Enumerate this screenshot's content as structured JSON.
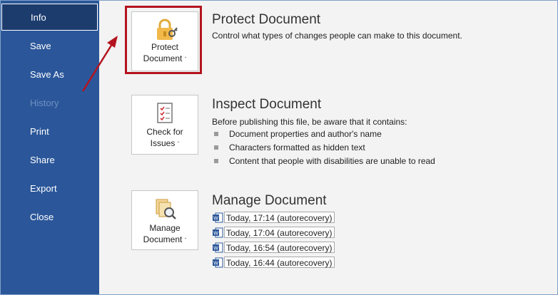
{
  "sidebar": {
    "items": [
      {
        "label": "Info",
        "active": true
      },
      {
        "label": "Save"
      },
      {
        "label": "Save As"
      },
      {
        "label": "History",
        "disabled": true
      },
      {
        "label": "Print"
      },
      {
        "label": "Share"
      },
      {
        "label": "Export"
      },
      {
        "label": "Close"
      }
    ]
  },
  "protect": {
    "button_line1": "Protect",
    "button_line2": "Document",
    "caret": "ˇ",
    "title": "Protect Document",
    "description": "Control what types of changes people can make to this document."
  },
  "inspect": {
    "button_line1": "Check for",
    "button_line2": "Issues",
    "caret": "ˇ",
    "title": "Inspect Document",
    "description": "Before publishing this file, be aware that it contains:",
    "bullets": [
      "Document properties and author's name",
      "Characters formatted as hidden text",
      "Content that people with disabilities are unable to read"
    ]
  },
  "manage": {
    "button_line1": "Manage",
    "button_line2": "Document",
    "caret": "ˇ",
    "title": "Manage Document",
    "versions": [
      "Today, 17:14 (autorecovery)",
      "Today, 17:04 (autorecovery)",
      "Today, 16:54 (autorecovery)",
      "Today, 16:44 (autorecovery)"
    ]
  },
  "colors": {
    "sidebar_bg": "#2b579a",
    "active_bg": "#1d3c6e",
    "highlight": "#b3141f",
    "content_bg": "#f3f3f3"
  },
  "icons": {
    "protect": "lock-key-icon",
    "inspect": "checklist-icon",
    "manage": "documents-magnifier-icon",
    "version": "word-doc-icon"
  }
}
